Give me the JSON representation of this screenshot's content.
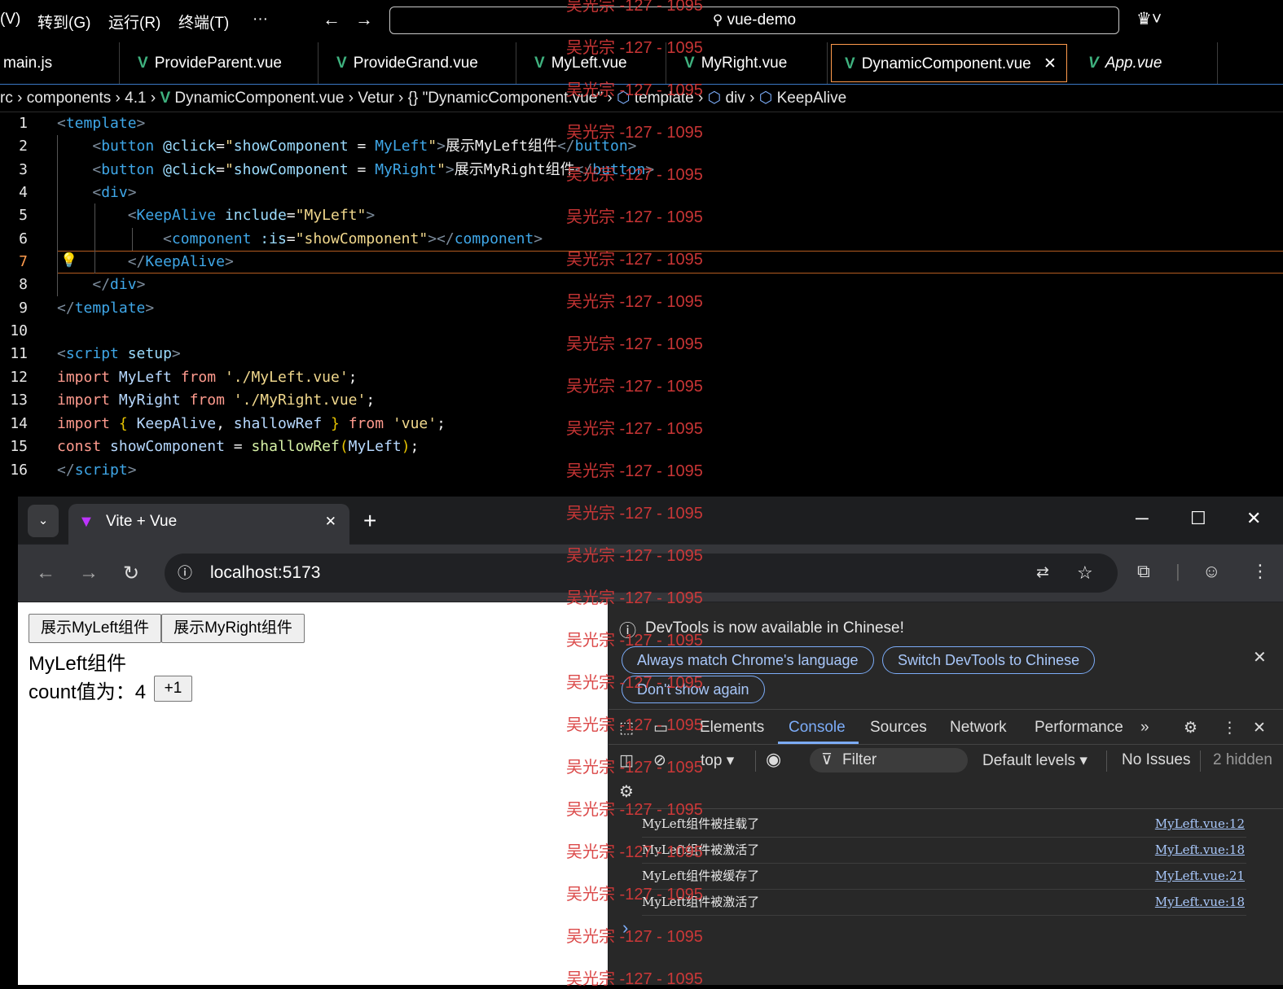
{
  "menubar": {
    "items": [
      "(V)",
      "转到(G)",
      "运行(R)",
      "终端(T)",
      "···"
    ],
    "back_icon": "arrow-left-icon",
    "forward_icon": "arrow-right-icon",
    "search_text": "vue-demo",
    "copilot_icon": "copilot-icon"
  },
  "editor_tabs": [
    {
      "label": "main.js"
    },
    {
      "label": "ProvideParent.vue"
    },
    {
      "label": "ProvideGrand.vue"
    },
    {
      "label": "MyLeft.vue"
    },
    {
      "label": "MyRight.vue"
    },
    {
      "label": "DynamicComponent.vue",
      "close": "✕"
    },
    {
      "label": "App.vue"
    }
  ],
  "breadcrumb": [
    "rc",
    "components",
    "4.1",
    "DynamicComponent.vue",
    "Vetur",
    "{} \"DynamicComponent.vue\"",
    "template",
    "div",
    "KeepAlive"
  ],
  "code": {
    "line_numbers": [
      "1",
      "2",
      "3",
      "4",
      "5",
      "6",
      "7",
      "8",
      "9",
      "10",
      "11",
      "12",
      "13",
      "14",
      "15",
      "16"
    ],
    "current_line": "7"
  },
  "browser": {
    "tab_title": "Vite + Vue",
    "tab_close": "✕",
    "new_tab": "+",
    "url": "localhost:5173",
    "window_controls": [
      "─",
      "☐",
      "✕"
    ]
  },
  "page": {
    "btn_left": "展示MyLeft组件",
    "btn_right": "展示MyRight组件",
    "component_title": "MyLeft组件",
    "count_label": "count值为：",
    "count_value": "4",
    "increment_btn": "+1"
  },
  "devtools": {
    "banner_text": "DevTools is now available in Chinese!",
    "pill_match": "Always match Chrome's language",
    "pill_switch": "Switch DevTools to Chinese",
    "pill_dont": "Don't show again",
    "tabs": [
      "Elements",
      "Console",
      "Sources",
      "Network",
      "Performance"
    ],
    "selected_tab": "Console",
    "context": "top",
    "filter_placeholder": "Filter",
    "levels": "Default levels",
    "issues": "No Issues",
    "hidden": "2 hidden",
    "logs": [
      {
        "text": "MyLeft组件被挂载了",
        "source": "MyLeft.vue:12"
      },
      {
        "text": "MyLeft组件被激活了",
        "source": "MyLeft.vue:18"
      },
      {
        "text": "MyLeft组件被缓存了",
        "source": "MyLeft.vue:21"
      },
      {
        "text": "MyLeft组件被激活了",
        "source": "MyLeft.vue:18"
      }
    ],
    "prompt": "›"
  },
  "watermark": "吴光宗 -127 - 1095",
  "colors": {
    "accent_orange": "#ff9b4d",
    "vue_green": "#3fb27f",
    "link_blue": "#a8c7fa"
  }
}
